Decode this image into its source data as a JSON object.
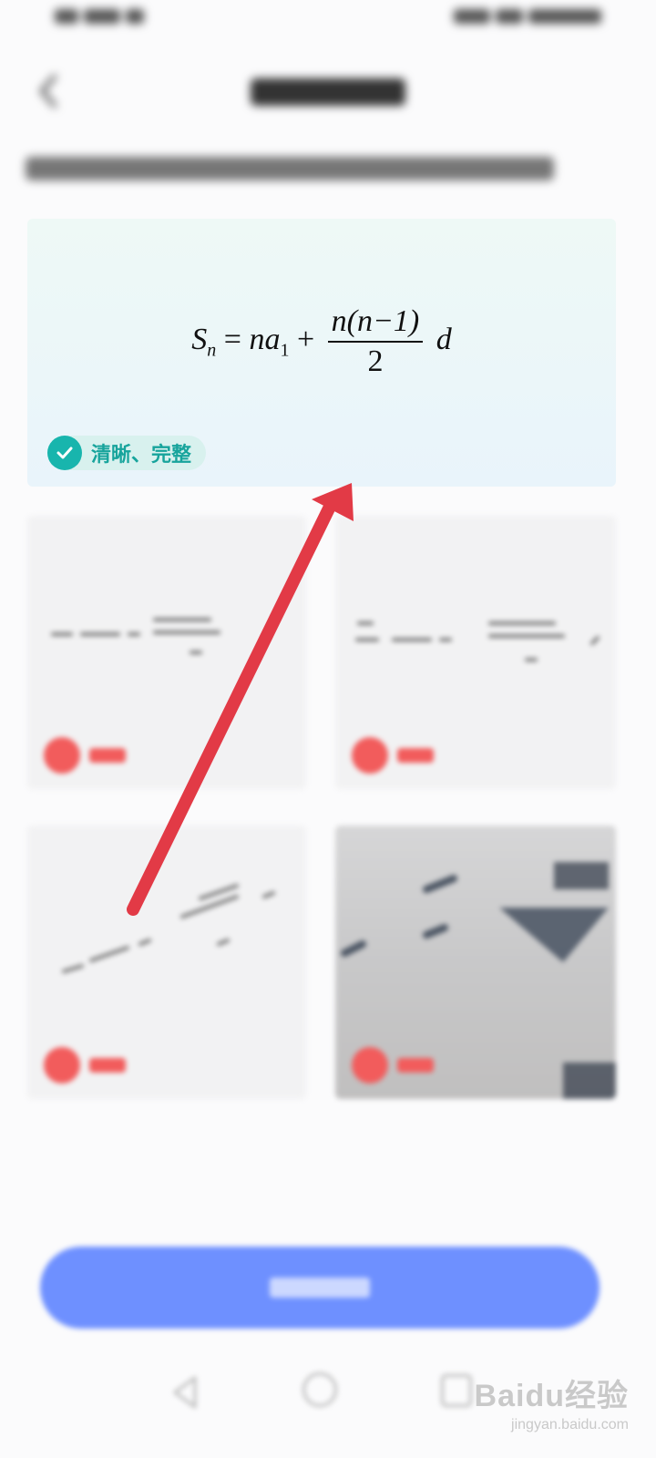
{
  "good_example": {
    "formula": {
      "S": "S",
      "n_sub": "n",
      "eq": "=",
      "na": "na",
      "one_sub": "1",
      "plus": "+",
      "numerator": "n(n−1)",
      "denominator": "2",
      "d": "d"
    },
    "badge_label": "清晰、完整"
  },
  "watermark": {
    "brand": "Baidu经验",
    "url": "jingyan.baidu.com"
  },
  "colors": {
    "good_accent": "#18b5ad",
    "bad_accent": "#f25c5c",
    "arrow": "#e23a46",
    "button": "#6e90ff"
  }
}
